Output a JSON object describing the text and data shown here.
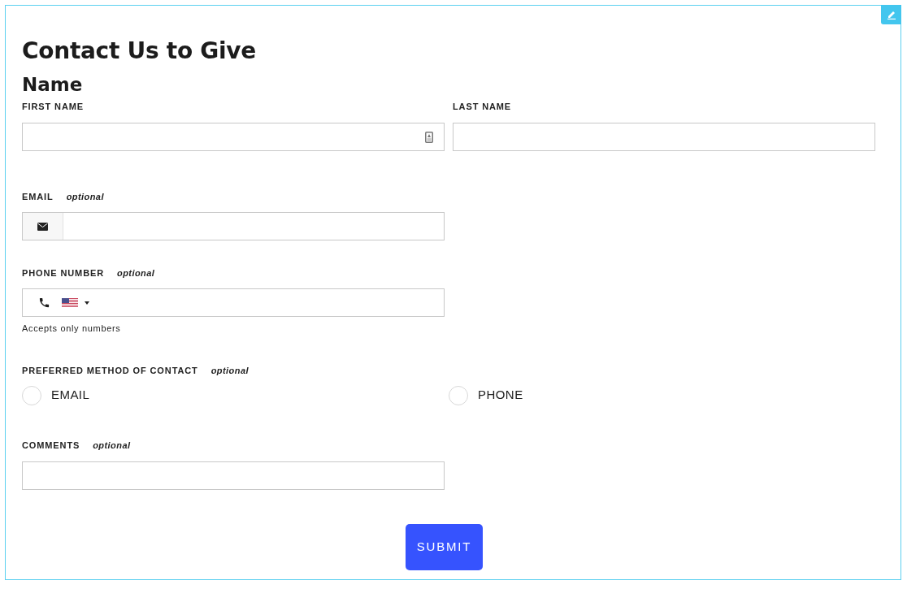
{
  "title": "Contact Us to Give",
  "section": "Name",
  "name_fields": [
    {
      "label": "FIRST NAME",
      "kind": "contact-card"
    },
    {
      "label": "LAST NAME",
      "kind": "plain"
    }
  ],
  "email": {
    "label": "EMAIL",
    "optional": "optional"
  },
  "phone": {
    "label": "PHONE NUMBER",
    "optional": "optional",
    "hint": "Accepts only numbers"
  },
  "contact_method": {
    "label": "PREFERRED METHOD OF CONTACT",
    "optional": "optional",
    "options": [
      {
        "label": "EMAIL",
        "selected": false
      },
      {
        "label": "PHONE",
        "selected": false
      }
    ]
  },
  "comments": {
    "label": "COMMENTS",
    "optional": "optional"
  },
  "submit": "SUBMIT"
}
